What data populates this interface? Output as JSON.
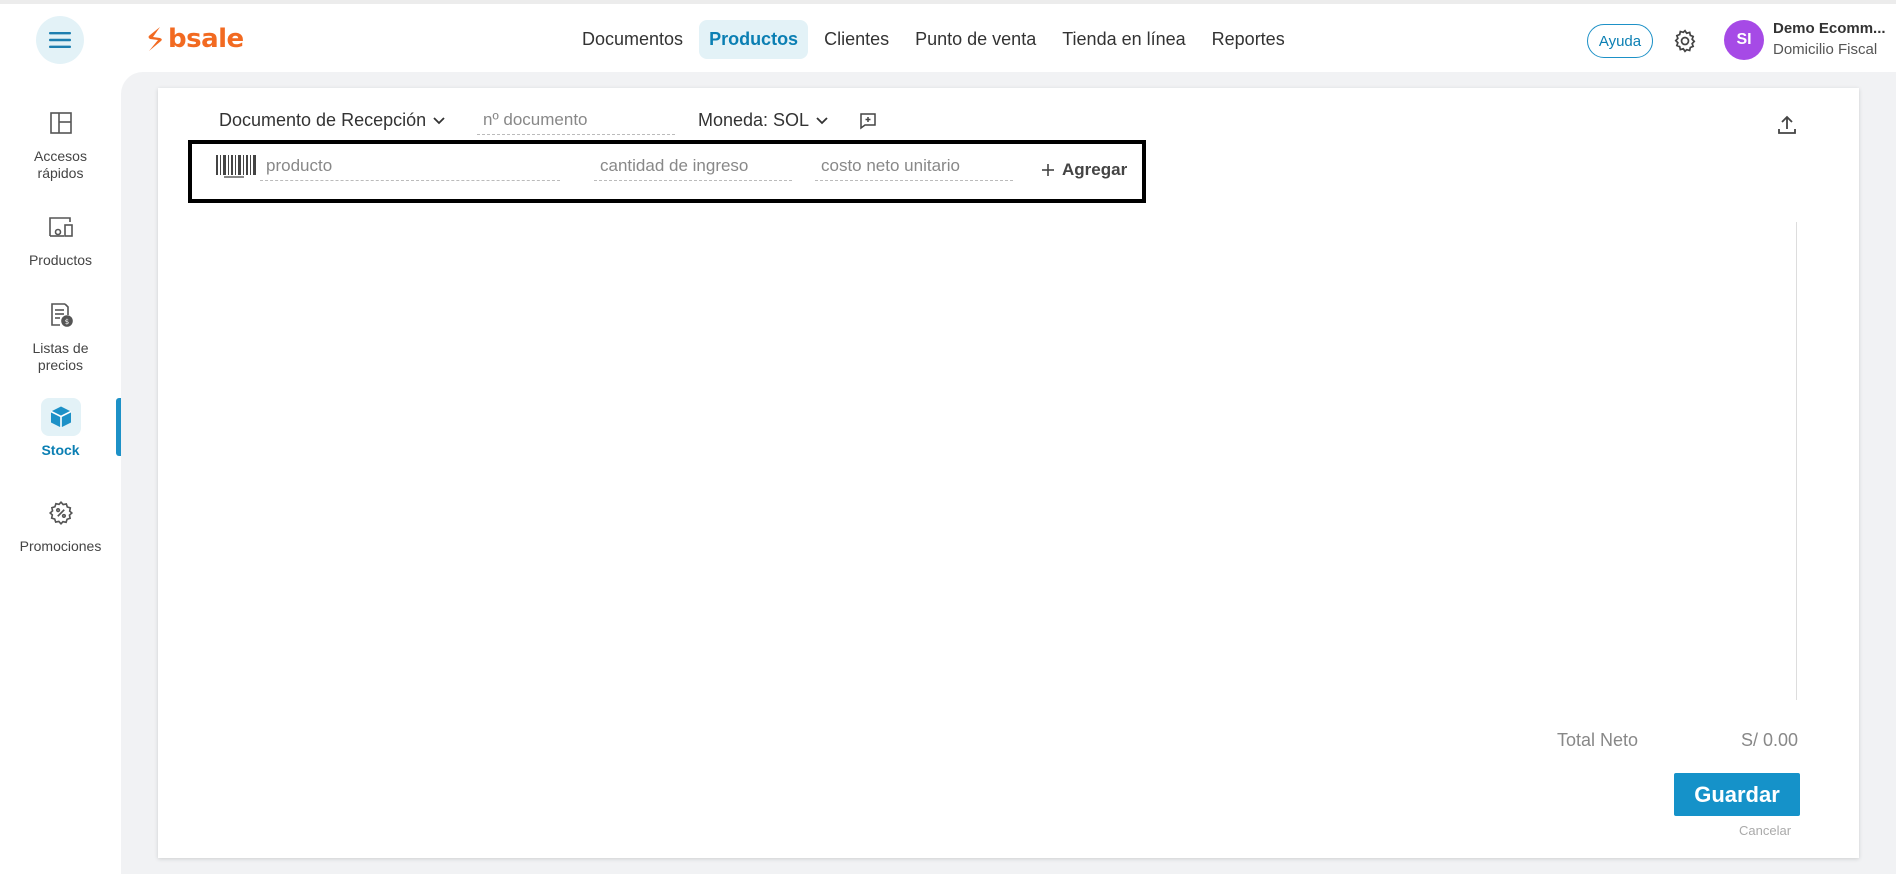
{
  "header": {
    "logo_text": "bsale",
    "nav": [
      "Documentos",
      "Productos",
      "Clientes",
      "Punto de venta",
      "Tienda en línea",
      "Reportes"
    ],
    "active_nav": "Productos",
    "help_label": "Ayuda",
    "avatar_initials": "SI",
    "company_name": "Demo Ecomm...",
    "company_sub": "Domicilio Fiscal"
  },
  "sidebar": {
    "items": [
      {
        "label": "Accesos rápidos",
        "icon": "layout-icon"
      },
      {
        "label": "Productos",
        "icon": "products-icon"
      },
      {
        "label": "Listas de precios",
        "icon": "price-list-icon"
      },
      {
        "label": "Stock",
        "icon": "box-icon",
        "active": true
      },
      {
        "label": "Promociones",
        "icon": "promo-icon"
      }
    ]
  },
  "form": {
    "document_type": "Documento de Recepción",
    "doc_number_placeholder": "nº documento",
    "currency": "Moneda: SOL",
    "product_placeholder": "producto",
    "quantity_placeholder": "cantidad de ingreso",
    "cost_placeholder": "costo neto unitario",
    "add_label": "Agregar"
  },
  "footer": {
    "total_label": "Total Neto",
    "total_value": "S/ 0.00",
    "save_label": "Guardar",
    "cancel_label": "Cancelar"
  },
  "colors": {
    "brand": "#f26a21",
    "accent": "#1592c9",
    "avatar": "#a64ae6"
  }
}
